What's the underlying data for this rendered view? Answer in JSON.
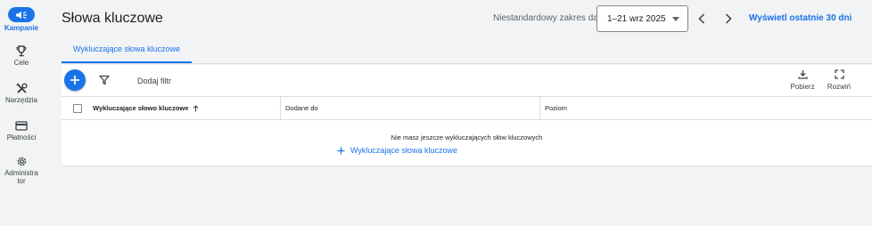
{
  "sidebar": {
    "items": [
      {
        "label": "Kampanie",
        "icon": "megaphone-icon",
        "active": true
      },
      {
        "label": "Cele",
        "icon": "trophy-icon"
      },
      {
        "label": "Narzędzia",
        "icon": "tools-icon"
      },
      {
        "label": "Płatności",
        "icon": "credit-card-icon"
      },
      {
        "label": "Administra\ntor",
        "icon": "gear-icon"
      }
    ]
  },
  "header": {
    "title": "Słowa kluczowe",
    "range_label": "Niestandardowy zakres dat",
    "date_range": "1–21 wrz 2025",
    "last30_label": "Wyświetl ostatnie 30 dni"
  },
  "tabs": [
    {
      "label": "Wykluczające słowa kluczowe",
      "active": true
    }
  ],
  "toolbar": {
    "add_filter": "Dodaj filtr",
    "download_label": "Pobierz",
    "expand_label": "Rozwiń"
  },
  "table": {
    "columns": [
      "Wykluczające słowo kluczowe",
      "Dodane do",
      "Poziom"
    ],
    "sort_column": "Wykluczające słowo kluczowe",
    "sort_direction": "ascending",
    "rows": []
  },
  "empty_state": {
    "message": "Nie masz jeszcze wykluczających słów kluczowych",
    "link_label": "Wykluczające słowa kluczowe"
  },
  "colors": {
    "accent": "#1a73e8",
    "background": "#f1f3f4",
    "text": "#202124",
    "border": "#dadce0"
  }
}
